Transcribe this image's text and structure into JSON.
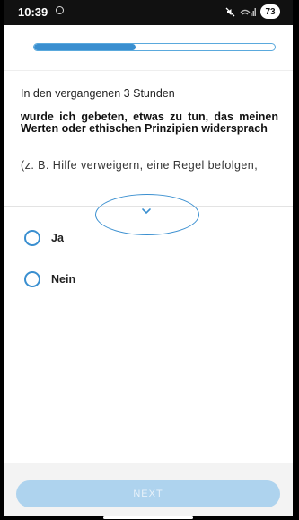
{
  "status_bar": {
    "time": "10:39",
    "battery": "73",
    "icons": [
      "camera-icon",
      "mute-icon",
      "signal-icon",
      "battery-icon"
    ]
  },
  "progress": {
    "fraction": 0.42,
    "color": "#3a8fd0"
  },
  "question": {
    "intro": "In den vergangenen 3 Stunden",
    "main": "wurde ich gebeten, etwas zu tun, das meinen Werten oder ethischen Prinzipien widersprach",
    "hint": "(z. B. Hilfe verweigern, eine Regel befolgen,",
    "expand_icon": "chevron-down-icon"
  },
  "options": [
    {
      "label": "Ja"
    },
    {
      "label": "Nein"
    }
  ],
  "footer": {
    "next_label": "NEXT"
  },
  "colors": {
    "accent": "#3a8fd0",
    "button_disabled": "#aed3ee"
  }
}
